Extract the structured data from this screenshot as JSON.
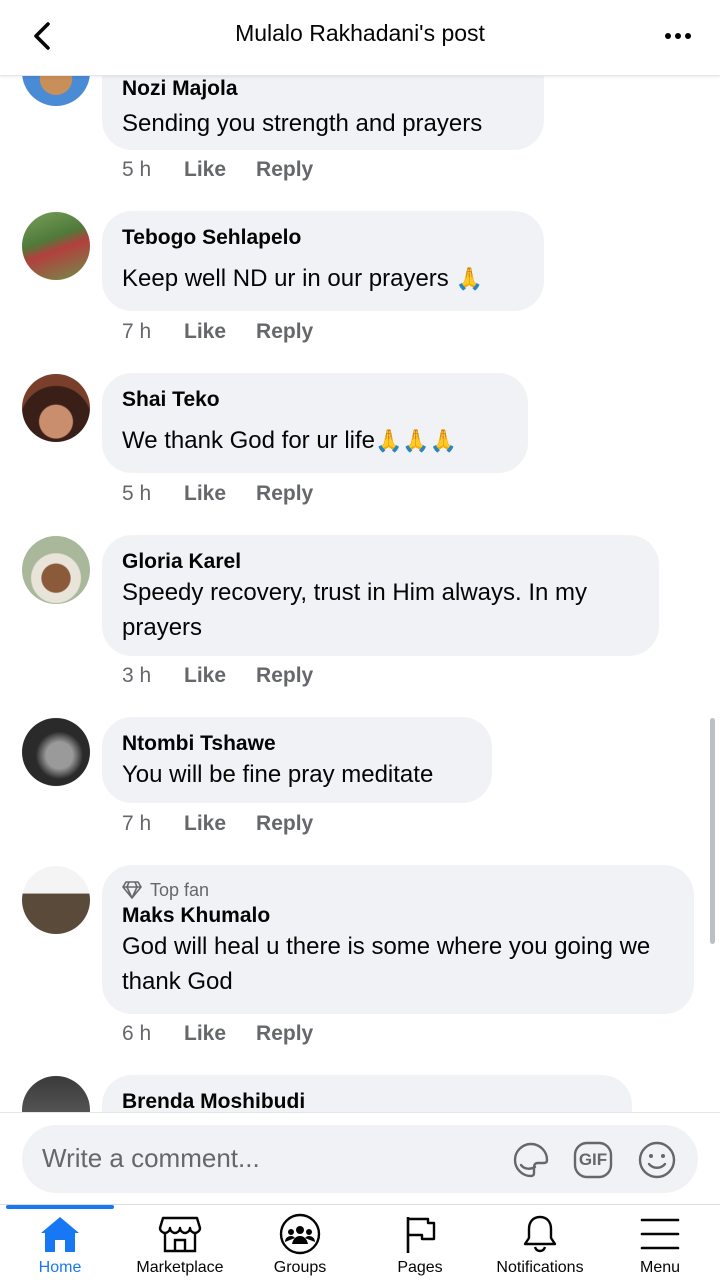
{
  "header": {
    "title": "Mulalo Rakhadani's post"
  },
  "comments": [
    {
      "author": "Nozi Majola",
      "text": "Sending you strength and prayers",
      "time": "5 h",
      "like": "Like",
      "reply": "Reply"
    },
    {
      "author": "Tebogo Sehlapelo",
      "text": "Keep well ND ur in our prayers",
      "emoji": "🙏",
      "time": "7 h",
      "like": "Like",
      "reply": "Reply"
    },
    {
      "author": "Shai Teko",
      "text": "We thank God for ur life",
      "emoji": "🙏🙏🙏",
      "time": "5 h",
      "like": "Like",
      "reply": "Reply"
    },
    {
      "author": "Gloria Karel",
      "text": "Speedy recovery, trust in Him always. In my prayers",
      "time": "3 h",
      "like": "Like",
      "reply": "Reply"
    },
    {
      "author": "Ntombi Tshawe",
      "text": "You will be fine pray meditate",
      "time": "7 h",
      "like": "Like",
      "reply": "Reply"
    },
    {
      "badge": "Top fan",
      "author": "Maks Khumalo",
      "text": "God will heal  u there is some where you going we thank God",
      "time": "6 h",
      "like": "Like",
      "reply": "Reply"
    },
    {
      "author": "Brenda Moshibudi"
    }
  ],
  "composer": {
    "placeholder": "Write a comment...",
    "gif_label": "GIF"
  },
  "tabbar": {
    "tabs": [
      {
        "label": "Home",
        "icon": "home-icon",
        "active": true
      },
      {
        "label": "Marketplace",
        "icon": "marketplace-icon"
      },
      {
        "label": "Groups",
        "icon": "groups-icon"
      },
      {
        "label": "Pages",
        "icon": "pages-flag-icon"
      },
      {
        "label": "Notifications",
        "icon": "bell-icon"
      },
      {
        "label": "Menu",
        "icon": "hamburger-icon"
      }
    ]
  },
  "colors": {
    "accent": "#1877f2",
    "bubble": "#f0f2f5",
    "secondary_text": "#65676b"
  }
}
